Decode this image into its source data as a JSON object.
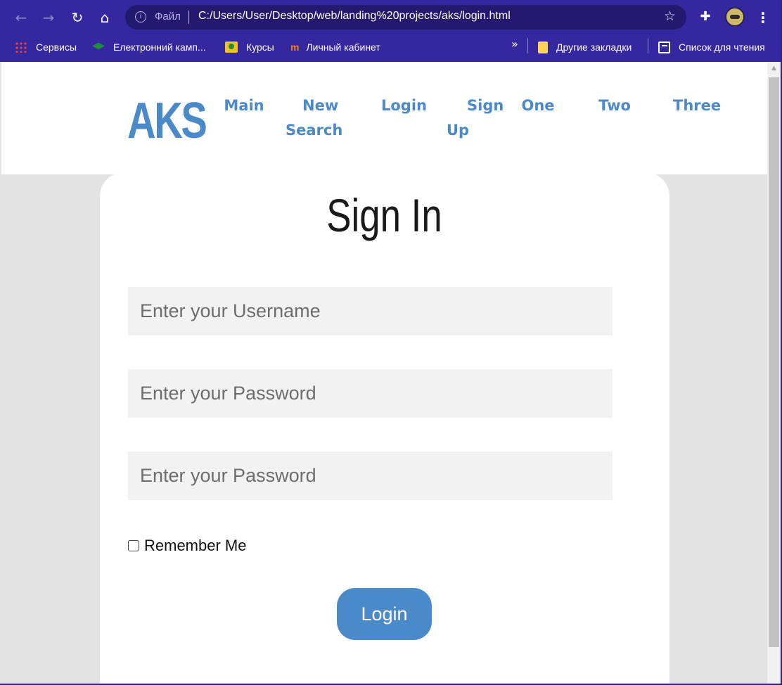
{
  "browser": {
    "url_scheme_label": "Файл",
    "url": "C:/Users/User/Desktop/web/landing%20projects/aks/login.html",
    "icons": [
      "back-arrow-icon",
      "forward-arrow-icon",
      "reload-icon",
      "home-icon",
      "info-icon",
      "star-icon",
      "puzzle-extension-icon",
      "profile-avatar",
      "kebab-menu-icon"
    ]
  },
  "bookmarks": {
    "items": [
      {
        "label": "Сервисы",
        "icon": "apps-grid-icon"
      },
      {
        "label": "Електронний камп...",
        "icon": "graduation-cap-icon"
      },
      {
        "label": "Курсы",
        "icon": "classroom-icon"
      },
      {
        "label": "Личный кабинет",
        "icon": "moodle-icon"
      }
    ],
    "overflow": "»",
    "other": {
      "label": "Другие закладки",
      "icon": "folder-icon"
    },
    "reading_list": {
      "label": "Список для чтения",
      "icon": "reading-list-icon"
    }
  },
  "site": {
    "logo": "AKS",
    "nav": {
      "main": "Main",
      "new_search_1": "New",
      "new_search_2": "Search",
      "login": "Login",
      "sign_up_1": "Sign",
      "sign_up_2": "Up",
      "one": "One",
      "two": "Two",
      "three": "Three"
    }
  },
  "form": {
    "title": "Sign In",
    "username_placeholder": "Enter your Username",
    "password_placeholder": "Enter your Password",
    "confirm_placeholder": "Enter your Password",
    "remember_label": "Remember Me",
    "remember_checked": false,
    "submit_label": "Login"
  },
  "colors": {
    "accent": "#4b8ac9",
    "browser_frame": "#35279f",
    "page_background": "#e3e3e3",
    "field_background": "#f2f2f2"
  }
}
